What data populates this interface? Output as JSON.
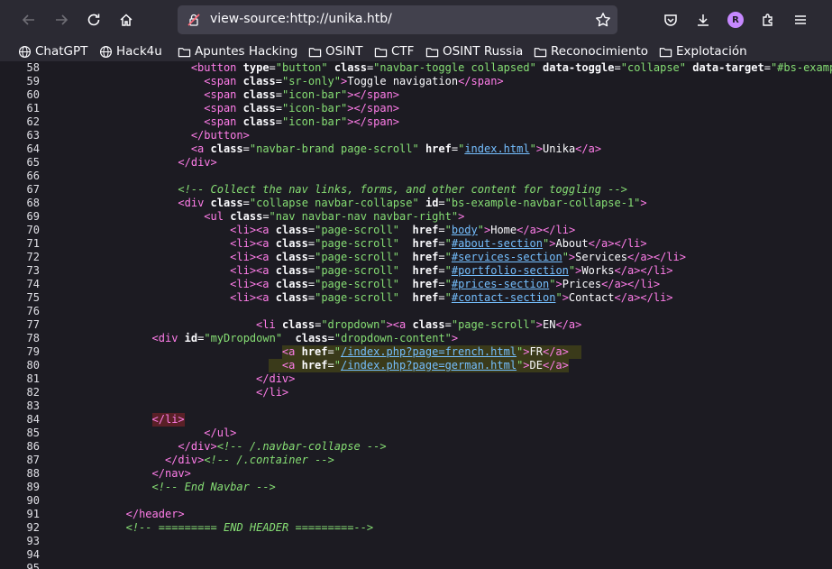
{
  "browser": {
    "url": "view-source:http://unika.htb/",
    "profile_initial": "R"
  },
  "bookmarks": [
    {
      "label": "ChatGPT",
      "icon": "globe-icon"
    },
    {
      "label": "Hack4u",
      "icon": "globe-icon"
    },
    {
      "label": "Apuntes Hacking",
      "icon": "folder-icon"
    },
    {
      "label": "OSINT",
      "icon": "folder-icon"
    },
    {
      "label": "CTF",
      "icon": "folder-icon"
    },
    {
      "label": "OSINT Russia",
      "icon": "folder-icon"
    },
    {
      "label": "Reconocimiento",
      "icon": "folder-icon"
    },
    {
      "label": "Explotación",
      "icon": "folder-icon"
    }
  ],
  "source_lines": [
    {
      "n": "58",
      "ind": 22,
      "segs": [
        [
          "t",
          "<button"
        ],
        [
          "d",
          " "
        ],
        [
          "a",
          "type"
        ],
        [
          "d",
          "="
        ],
        [
          "v",
          "\"button\""
        ],
        [
          "d",
          " "
        ],
        [
          "a",
          "class"
        ],
        [
          "d",
          "="
        ],
        [
          "v",
          "\"navbar-toggle collapsed\""
        ],
        [
          "d",
          " "
        ],
        [
          "a",
          "data-toggle"
        ],
        [
          "d",
          "="
        ],
        [
          "v",
          "\"collapse\""
        ],
        [
          "d",
          " "
        ],
        [
          "a",
          "data-target"
        ],
        [
          "d",
          "="
        ],
        [
          "v",
          "\"#bs-example"
        ]
      ]
    },
    {
      "n": "59",
      "ind": 24,
      "segs": [
        [
          "t",
          "<span"
        ],
        [
          "d",
          " "
        ],
        [
          "a",
          "class"
        ],
        [
          "d",
          "="
        ],
        [
          "v",
          "\"sr-only\""
        ],
        [
          "t",
          ">"
        ],
        [
          "d",
          "Toggle navigation"
        ],
        [
          "t",
          "</span>"
        ]
      ]
    },
    {
      "n": "60",
      "ind": 24,
      "segs": [
        [
          "t",
          "<span"
        ],
        [
          "d",
          " "
        ],
        [
          "a",
          "class"
        ],
        [
          "d",
          "="
        ],
        [
          "v",
          "\"icon-bar\""
        ],
        [
          "t",
          "></span>"
        ]
      ]
    },
    {
      "n": "61",
      "ind": 24,
      "segs": [
        [
          "t",
          "<span"
        ],
        [
          "d",
          " "
        ],
        [
          "a",
          "class"
        ],
        [
          "d",
          "="
        ],
        [
          "v",
          "\"icon-bar\""
        ],
        [
          "t",
          "></span>"
        ]
      ]
    },
    {
      "n": "62",
      "ind": 24,
      "segs": [
        [
          "t",
          "<span"
        ],
        [
          "d",
          " "
        ],
        [
          "a",
          "class"
        ],
        [
          "d",
          "="
        ],
        [
          "v",
          "\"icon-bar\""
        ],
        [
          "t",
          "></span>"
        ]
      ]
    },
    {
      "n": "63",
      "ind": 22,
      "segs": [
        [
          "t",
          "</button>"
        ]
      ]
    },
    {
      "n": "64",
      "ind": 22,
      "segs": [
        [
          "t",
          "<a"
        ],
        [
          "d",
          " "
        ],
        [
          "a",
          "class"
        ],
        [
          "d",
          "="
        ],
        [
          "v",
          "\"navbar-brand page-scroll\""
        ],
        [
          "d",
          " "
        ],
        [
          "a",
          "href"
        ],
        [
          "d",
          "="
        ],
        [
          "v",
          "\""
        ],
        [
          "lnk",
          "index.html"
        ],
        [
          "v",
          "\""
        ],
        [
          "t",
          ">"
        ],
        [
          "d",
          "Unika"
        ],
        [
          "t",
          "</a>"
        ]
      ]
    },
    {
      "n": "65",
      "ind": 20,
      "segs": [
        [
          "t",
          "</div>"
        ]
      ]
    },
    {
      "n": "66",
      "ind": 0,
      "segs": []
    },
    {
      "n": "67",
      "ind": 20,
      "segs": [
        [
          "c",
          "<!-- Collect the nav links, forms, and other content for toggling -->"
        ]
      ]
    },
    {
      "n": "68",
      "ind": 20,
      "segs": [
        [
          "t",
          "<div"
        ],
        [
          "d",
          " "
        ],
        [
          "a",
          "class"
        ],
        [
          "d",
          "="
        ],
        [
          "v",
          "\"collapse navbar-collapse\""
        ],
        [
          "d",
          " "
        ],
        [
          "a",
          "id"
        ],
        [
          "d",
          "="
        ],
        [
          "v",
          "\"bs-example-navbar-collapse-1\""
        ],
        [
          "t",
          ">"
        ]
      ]
    },
    {
      "n": "69",
      "ind": 24,
      "segs": [
        [
          "t",
          "<ul"
        ],
        [
          "d",
          " "
        ],
        [
          "a",
          "class"
        ],
        [
          "d",
          "="
        ],
        [
          "v",
          "\"nav navbar-nav navbar-right\""
        ],
        [
          "t",
          ">"
        ]
      ]
    },
    {
      "n": "70",
      "ind": 28,
      "segs": [
        [
          "t",
          "<li><a"
        ],
        [
          "d",
          " "
        ],
        [
          "a",
          "class"
        ],
        [
          "d",
          "="
        ],
        [
          "v",
          "\"page-scroll\""
        ],
        [
          "d",
          "  "
        ],
        [
          "a",
          "href"
        ],
        [
          "d",
          "="
        ],
        [
          "v",
          "\""
        ],
        [
          "lnk",
          "body"
        ],
        [
          "v",
          "\""
        ],
        [
          "t",
          ">"
        ],
        [
          "d",
          "Home"
        ],
        [
          "t",
          "</a></li>"
        ]
      ]
    },
    {
      "n": "71",
      "ind": 28,
      "segs": [
        [
          "t",
          "<li><a"
        ],
        [
          "d",
          " "
        ],
        [
          "a",
          "class"
        ],
        [
          "d",
          "="
        ],
        [
          "v",
          "\"page-scroll\""
        ],
        [
          "d",
          "  "
        ],
        [
          "a",
          "href"
        ],
        [
          "d",
          "="
        ],
        [
          "v",
          "\""
        ],
        [
          "lnk",
          "#about-section"
        ],
        [
          "v",
          "\""
        ],
        [
          "t",
          ">"
        ],
        [
          "d",
          "About"
        ],
        [
          "t",
          "</a></li>"
        ]
      ]
    },
    {
      "n": "72",
      "ind": 28,
      "segs": [
        [
          "t",
          "<li><a"
        ],
        [
          "d",
          " "
        ],
        [
          "a",
          "class"
        ],
        [
          "d",
          "="
        ],
        [
          "v",
          "\"page-scroll\""
        ],
        [
          "d",
          "  "
        ],
        [
          "a",
          "href"
        ],
        [
          "d",
          "="
        ],
        [
          "v",
          "\""
        ],
        [
          "lnk",
          "#services-section"
        ],
        [
          "v",
          "\""
        ],
        [
          "t",
          ">"
        ],
        [
          "d",
          "Services"
        ],
        [
          "t",
          "</a></li>"
        ]
      ]
    },
    {
      "n": "73",
      "ind": 28,
      "segs": [
        [
          "t",
          "<li><a"
        ],
        [
          "d",
          " "
        ],
        [
          "a",
          "class"
        ],
        [
          "d",
          "="
        ],
        [
          "v",
          "\"page-scroll\""
        ],
        [
          "d",
          "  "
        ],
        [
          "a",
          "href"
        ],
        [
          "d",
          "="
        ],
        [
          "v",
          "\""
        ],
        [
          "lnk",
          "#portfolio-section"
        ],
        [
          "v",
          "\""
        ],
        [
          "t",
          ">"
        ],
        [
          "d",
          "Works"
        ],
        [
          "t",
          "</a></li>"
        ]
      ]
    },
    {
      "n": "74",
      "ind": 28,
      "segs": [
        [
          "t",
          "<li><a"
        ],
        [
          "d",
          " "
        ],
        [
          "a",
          "class"
        ],
        [
          "d",
          "="
        ],
        [
          "v",
          "\"page-scroll\""
        ],
        [
          "d",
          "  "
        ],
        [
          "a",
          "href"
        ],
        [
          "d",
          "="
        ],
        [
          "v",
          "\""
        ],
        [
          "lnk",
          "#prices-section"
        ],
        [
          "v",
          "\""
        ],
        [
          "t",
          ">"
        ],
        [
          "d",
          "Prices"
        ],
        [
          "t",
          "</a></li>"
        ]
      ]
    },
    {
      "n": "75",
      "ind": 28,
      "segs": [
        [
          "t",
          "<li><a"
        ],
        [
          "d",
          " "
        ],
        [
          "a",
          "class"
        ],
        [
          "d",
          "="
        ],
        [
          "v",
          "\"page-scroll\""
        ],
        [
          "d",
          "  "
        ],
        [
          "a",
          "href"
        ],
        [
          "d",
          "="
        ],
        [
          "v",
          "\""
        ],
        [
          "lnk",
          "#contact-section"
        ],
        [
          "v",
          "\""
        ],
        [
          "t",
          ">"
        ],
        [
          "d",
          "Contact"
        ],
        [
          "t",
          "</a></li>"
        ]
      ]
    },
    {
      "n": "76",
      "ind": 0,
      "segs": []
    },
    {
      "n": "77",
      "ind": 32,
      "segs": [
        [
          "t",
          "<li"
        ],
        [
          "d",
          " "
        ],
        [
          "a",
          "class"
        ],
        [
          "d",
          "="
        ],
        [
          "v",
          "\"dropdown\""
        ],
        [
          "t",
          "><a"
        ],
        [
          "d",
          " "
        ],
        [
          "a",
          "class"
        ],
        [
          "d",
          "="
        ],
        [
          "v",
          "\"page-scroll\""
        ],
        [
          "t",
          ">"
        ],
        [
          "d",
          "EN"
        ],
        [
          "t",
          "</a>"
        ]
      ]
    },
    {
      "n": "78",
      "ind": 16,
      "segs": [
        [
          "t",
          "<div"
        ],
        [
          "d",
          " "
        ],
        [
          "a",
          "id"
        ],
        [
          "d",
          "="
        ],
        [
          "v",
          "\"myDropdown\""
        ],
        [
          "d",
          "  "
        ],
        [
          "a",
          "class"
        ],
        [
          "d",
          "="
        ],
        [
          "v",
          "\"dropdown-content\""
        ],
        [
          "t",
          ">"
        ]
      ]
    },
    {
      "n": "79",
      "ind": 36,
      "hl": "hl",
      "segs": [
        [
          "t",
          "<a"
        ],
        [
          "d",
          " "
        ],
        [
          "a",
          "href"
        ],
        [
          "d",
          "="
        ],
        [
          "v",
          "\""
        ],
        [
          "lnk",
          "/index.php?page=french.html"
        ],
        [
          "v",
          "\""
        ],
        [
          "t",
          ">"
        ],
        [
          "d",
          "FR"
        ],
        [
          "t",
          "</a>"
        ],
        [
          "d",
          "  "
        ]
      ]
    },
    {
      "n": "80",
      "ind": 34,
      "hl": "hl",
      "segs": [
        [
          "d",
          "  "
        ],
        [
          "t",
          "<a"
        ],
        [
          "d",
          " "
        ],
        [
          "a",
          "href"
        ],
        [
          "d",
          "="
        ],
        [
          "v",
          "\""
        ],
        [
          "lnk",
          "/index.php?page=german.html"
        ],
        [
          "v",
          "\""
        ],
        [
          "t",
          ">"
        ],
        [
          "d",
          "DE"
        ],
        [
          "t",
          "</a>"
        ]
      ]
    },
    {
      "n": "81",
      "ind": 32,
      "segs": [
        [
          "t",
          "</div>"
        ]
      ]
    },
    {
      "n": "82",
      "ind": 32,
      "segs": [
        [
          "t",
          "</li>"
        ]
      ]
    },
    {
      "n": "83",
      "ind": 0,
      "segs": []
    },
    {
      "n": "84",
      "ind": 16,
      "hl": "hlsel",
      "segs": [
        [
          "t",
          "</li>"
        ]
      ]
    },
    {
      "n": "85",
      "ind": 24,
      "segs": [
        [
          "t",
          "</ul>"
        ]
      ]
    },
    {
      "n": "86",
      "ind": 20,
      "segs": [
        [
          "t",
          "</div>"
        ],
        [
          "c",
          "<!-- /.navbar-collapse -->"
        ]
      ]
    },
    {
      "n": "87",
      "ind": 18,
      "segs": [
        [
          "t",
          "</div>"
        ],
        [
          "c",
          "<!-- /.container -->"
        ]
      ]
    },
    {
      "n": "88",
      "ind": 16,
      "segs": [
        [
          "t",
          "</nav>"
        ]
      ]
    },
    {
      "n": "89",
      "ind": 16,
      "segs": [
        [
          "c",
          "<!-- End Navbar -->"
        ]
      ]
    },
    {
      "n": "90",
      "ind": 0,
      "segs": []
    },
    {
      "n": "91",
      "ind": 12,
      "segs": [
        [
          "t",
          "</header>"
        ]
      ]
    },
    {
      "n": "92",
      "ind": 12,
      "segs": [
        [
          "c",
          "<!-- ========= END HEADER =========-->"
        ]
      ]
    },
    {
      "n": "93",
      "ind": 0,
      "segs": []
    },
    {
      "n": "94",
      "ind": 0,
      "segs": []
    },
    {
      "n": "95",
      "ind": 0,
      "segs": []
    }
  ]
}
